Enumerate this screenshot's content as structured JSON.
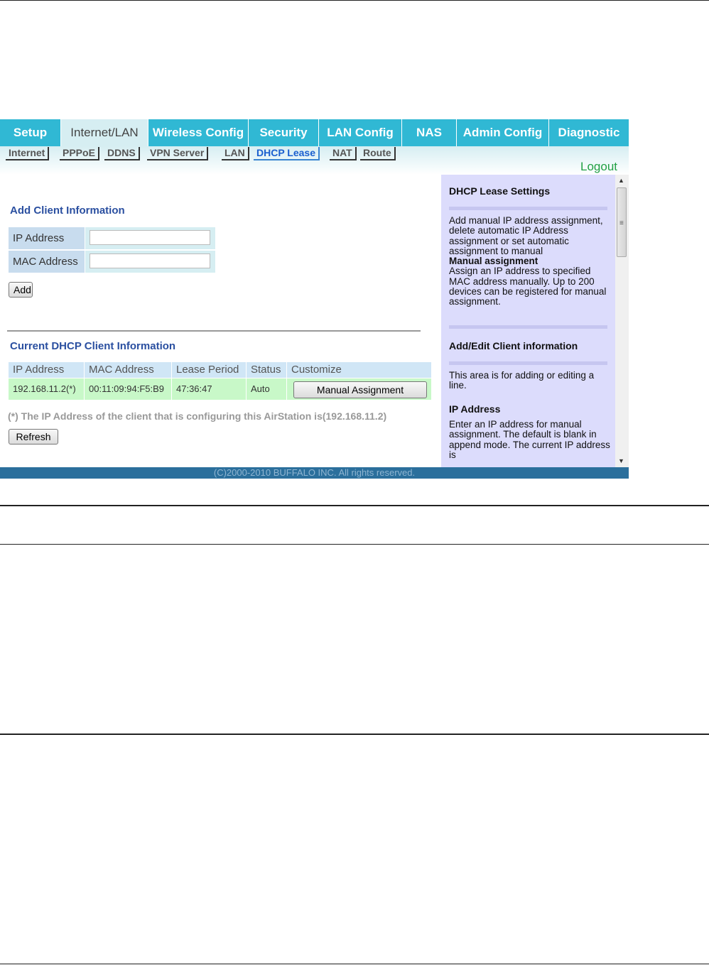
{
  "top_nav": [
    {
      "label": "Setup"
    },
    {
      "label": "Internet/LAN"
    },
    {
      "label": "Wireless Config"
    },
    {
      "label": "Security"
    },
    {
      "label": "LAN Config"
    },
    {
      "label": "NAS"
    },
    {
      "label": "Admin Config"
    },
    {
      "label": "Diagnostic"
    }
  ],
  "sub_nav": [
    "Internet",
    "PPPoE",
    "DDNS",
    "VPN Server",
    "LAN",
    "DHCP Lease",
    "NAT",
    "Route"
  ],
  "logout": "Logout",
  "add_client": {
    "title": "Add Client Information",
    "ip_label": "IP Address",
    "mac_label": "MAC Address",
    "ip_value": "",
    "mac_value": "",
    "add_button": "Add"
  },
  "current": {
    "title": "Current DHCP Client Information",
    "columns": [
      "IP Address",
      "MAC Address",
      "Lease Period",
      "Status",
      "Customize"
    ],
    "row": {
      "ip": "192.168.11.2(*)",
      "mac": "00:11:09:94:F5:B9",
      "lease": "47:36:47",
      "status": "Auto",
      "action": "Manual Assignment"
    },
    "note": "(*) The IP Address of the client that is configuring this AirStation is(192.168.11.2)",
    "refresh_button": "Refresh"
  },
  "help": {
    "h1": "DHCP Lease Settings",
    "p1": "Add manual IP address assignment, delete automatic IP Address assignment or set automatic assignment to manual",
    "p1_bold": "Manual assignment",
    "p1_rest": "Assign an IP address to specified MAC address manually. Up to 200 devices can be registered for manual assignment.",
    "h2": "Add/Edit Client information",
    "p2": "This area is for adding or editing a line.",
    "h3": "IP Address",
    "p3": "Enter an IP address for manual assignment. The default is blank in append mode. The current IP address is"
  },
  "footer": "(C)2000-2010 BUFFALO INC. All rights reserved."
}
